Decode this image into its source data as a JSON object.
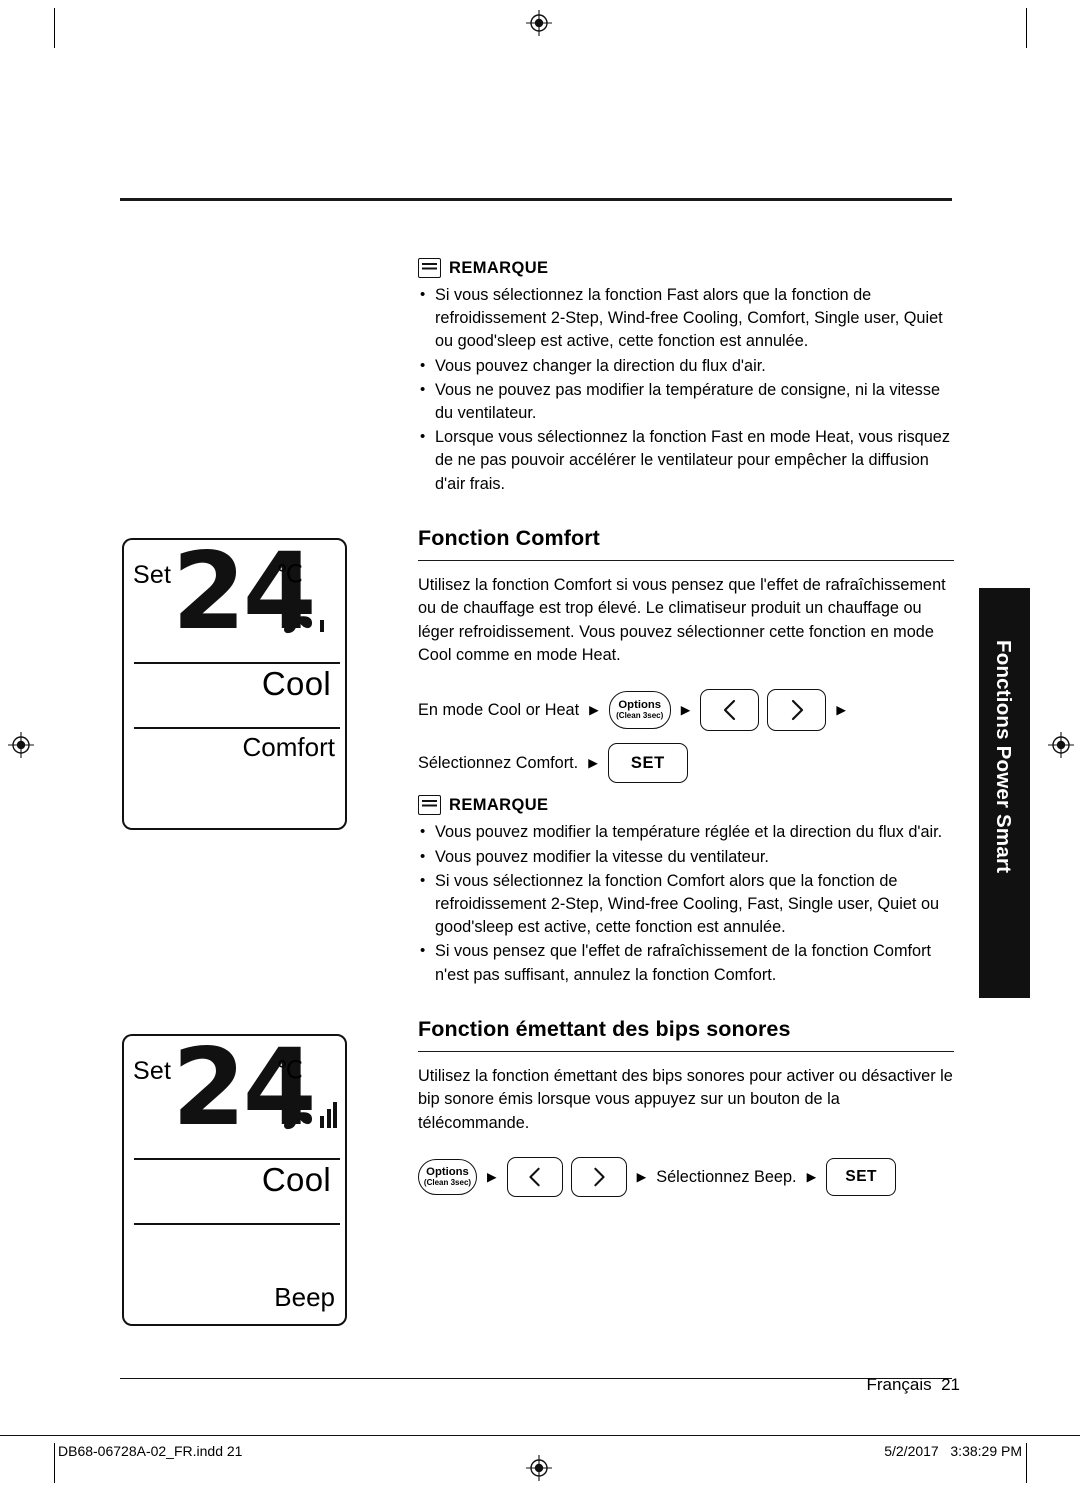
{
  "page": {
    "side_tab_label": "Fonctions Power Smart",
    "footer": {
      "language": "Français",
      "page_number": "21",
      "file_name": "DB68-06728A-02_FR.indd   21",
      "date": "5/2/2017",
      "time": "3:38:29 PM"
    }
  },
  "note_top": {
    "title": "REMARQUE",
    "icon": "note-icon",
    "items": [
      "Si vous sélectionnez la fonction Fast alors que la fonction de refroidissement 2-Step, Wind-free Cooling, Comfort, Single user, Quiet ou good'sleep est active, cette fonction est annulée.",
      "Vous pouvez changer la direction du flux d'air.",
      "Vous ne pouvez pas modifier la température de consigne, ni la vitesse du ventilateur.",
      "Lorsque vous sélectionnez la fonction Fast en mode Heat, vous risquez de ne pas pouvoir accélérer le ventilateur pour empêcher la diffusion d'air frais."
    ]
  },
  "comfort": {
    "heading": "Fonction Comfort",
    "body": "Utilisez la fonction Comfort si vous pensez que l'effet de rafraîchissement ou de chauffage est trop élevé. Le climatiseur produit un chauffage ou léger refroidissement. Vous pouvez sélectionner cette fonction en mode Cool comme en mode Heat.",
    "step1_text": "En mode Cool or Heat",
    "step2_text": "Sélectionnez Comfort.",
    "options_label_1": "Options",
    "options_label_2": "(Clean 3sec)",
    "set_label": "SET",
    "arrow": "▶"
  },
  "note_comfort": {
    "title": "REMARQUE",
    "items": [
      "Vous pouvez modifier la température réglée et la direction du flux d'air.",
      "Vous pouvez modifier la vitesse du ventilateur.",
      "Si vous sélectionnez la fonction Comfort alors que la fonction de refroidissement 2-Step, Wind-free Cooling, Fast, Single user, Quiet ou good'sleep est active, cette fonction est annulée.",
      "Si vous pensez que l'effet de rafraîchissement de la fonction Comfort n'est pas suffisant, annulez la fonction Comfort."
    ]
  },
  "beep": {
    "heading": "Fonction émettant des bips sonores",
    "body": "Utilisez la fonction émettant des bips sonores pour activer ou désactiver le bip sonore émis lorsque vous appuyez sur un bouton de la télécommande.",
    "step_text": "Sélectionnez Beep.",
    "options_label_1": "Options",
    "options_label_2": "(Clean 3sec)",
    "set_label": "SET",
    "arrow": "▶"
  },
  "lcd_comfort": {
    "set_label": "Set",
    "temperature": "24",
    "unit": "℃",
    "mode": "Cool",
    "function_label": "Comfort",
    "fan_icon": "fan-icon",
    "fan_bars": 1
  },
  "lcd_beep": {
    "set_label": "Set",
    "temperature": "24",
    "unit": "℃",
    "mode": "Cool",
    "function_label": "Beep",
    "fan_icon": "fan-icon",
    "fan_bars": 3
  }
}
